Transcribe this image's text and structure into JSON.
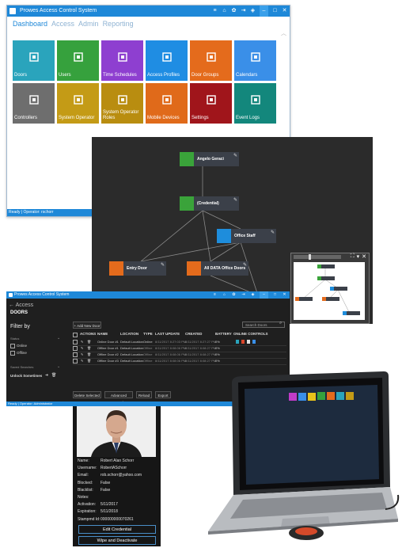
{
  "window1": {
    "title": "Prowes Access Control System",
    "nav": [
      "Dashboard",
      "Access",
      "Admin",
      "Reporting"
    ],
    "tiles": [
      {
        "label": "Doors",
        "color": "#2aa4bc",
        "icon": "door-icon"
      },
      {
        "label": "Users",
        "color": "#36a13d",
        "icon": "users-icon"
      },
      {
        "label": "Time Schedules",
        "color": "#8e3fd0",
        "icon": "clock-icon"
      },
      {
        "label": "Access Profiles",
        "color": "#1f8de3",
        "icon": "cube-icon"
      },
      {
        "label": "Door Groups",
        "color": "#e46b1c",
        "icon": "building-icon"
      },
      {
        "label": "Calendars",
        "color": "#3a8fe8",
        "icon": "calendar-icon"
      },
      {
        "label": "Controllers",
        "color": "#6e6e6e",
        "icon": "controller-icon"
      },
      {
        "label": "System Operator",
        "color": "#c49b16",
        "icon": "person-icon"
      },
      {
        "label": "System Operator Roles",
        "color": "#b98d10",
        "icon": "person-roles-icon"
      },
      {
        "label": "Mobile Devices",
        "color": "#e06a1a",
        "icon": "phone-icon"
      },
      {
        "label": "Settings",
        "color": "#a0151b",
        "icon": "settings-icon"
      },
      {
        "label": "Event Logs",
        "color": "#13877c",
        "icon": "log-icon"
      }
    ],
    "status": "Ready | Operator: rschorr"
  },
  "window2": {
    "nodes": [
      {
        "id": "angelo",
        "label": "Angelo Geraci",
        "color": "#3aa33a",
        "icon": "users-icon"
      },
      {
        "id": "credential",
        "label": "(Credential)",
        "color": "#3aa33a",
        "icon": "users-icon"
      },
      {
        "id": "office",
        "label": "Office Staff",
        "color": "#1e8ddc",
        "icon": "cube-icon"
      },
      {
        "id": "entry",
        "label": "Entry Door",
        "color": "#e46b1c",
        "icon": "building-icon"
      },
      {
        "id": "alldata",
        "label": "All DATA Office Doors",
        "color": "#e46b1c",
        "icon": "building-icon"
      }
    ]
  },
  "window3": {
    "title": "Prowes Access Control System",
    "back": "Access",
    "heading": "DOORS",
    "filter_by": "Filter by",
    "filter_group": "Status",
    "filter_options": [
      "Online",
      "Offline"
    ],
    "saved_searches": "Saved Searches",
    "unlock": "Unlock Sometimes",
    "add_new": "+ Add New Door",
    "search_placeholder": "Search Doors",
    "columns": [
      "ACTIONS",
      "NAME",
      "LOCATION",
      "TYPE",
      "LAST UPDATE",
      "CREATED",
      "BATTERY",
      "ONLINE CONTROLS"
    ],
    "rows": [
      {
        "name": "Online Door #1",
        "location": "Default Location",
        "type": "Online",
        "last_update": "8/11/2017 8:27:03 PM",
        "created": "8/11/2017 8:27:27 PM",
        "battery": "0%"
      },
      {
        "name": "Offline Door #1",
        "location": "Default Location",
        "type": "Offline",
        "last_update": "8/11/2017 8:08:06 PM",
        "created": "8/11/2017 8:08:27 PM",
        "battery": "0%"
      },
      {
        "name": "Offline Door #2",
        "location": "Default Location",
        "type": "Offline",
        "last_update": "8/11/2017 8:08:06 PM",
        "created": "8/11/2017 8:08:27 PM",
        "battery": "0%"
      },
      {
        "name": "Offline Door #3",
        "location": "Default Location",
        "type": "Offline",
        "last_update": "8/11/2017 8:08:06 PM",
        "created": "8/11/2017 8:08:27 PM",
        "battery": "0%"
      }
    ],
    "buttons": [
      "Delete Selected",
      "Advanced Search",
      "Reload",
      "Export"
    ],
    "status": "Ready | Operator: Administrator"
  },
  "phone": {
    "fields": [
      {
        "label": "Name:",
        "value": "Robert Alan Schorr"
      },
      {
        "label": "Username:",
        "value": "RobertASchorr"
      },
      {
        "label": "Email:",
        "value": "rob.schorr@yahoo.com"
      },
      {
        "label": "Blocked:",
        "value": "False"
      },
      {
        "label": "Blacklist:",
        "value": "False"
      },
      {
        "label": "Notes:",
        "value": ""
      },
      {
        "label": "Activation:",
        "value": "5/11/2017"
      },
      {
        "label": "Expiration:",
        "value": "5/11/2018"
      },
      {
        "label": "Stampmd Id:",
        "value": "000000000070261"
      }
    ],
    "edit_button": "Edit Credential",
    "wipe_button": "Wipe and Deactivate"
  }
}
